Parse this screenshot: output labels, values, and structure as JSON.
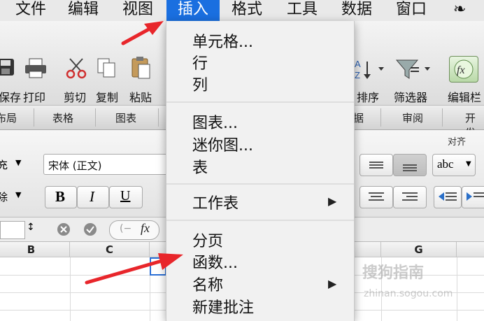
{
  "menubar": {
    "items": [
      "文件",
      "编辑",
      "视图",
      "插入",
      "格式",
      "工具",
      "数据",
      "窗口"
    ],
    "active_index": 3
  },
  "toolbar": {
    "save_label": "保存",
    "print_label": "打印",
    "cut_label": "剪切",
    "copy_label": "复制",
    "paste_label": "粘贴",
    "sort_label": "排序",
    "filter_label": "筛选器",
    "formula_builder_label": "编辑栏"
  },
  "ribbon_tabs": [
    "布局",
    "表格",
    "图表",
    "数据",
    "审阅",
    "开发"
  ],
  "format": {
    "section_label": "对齐",
    "font_name": "宋体 (正文)",
    "bold_label": "B",
    "italic_label": "I",
    "underline_label": "U",
    "wrap_label": "abc"
  },
  "formula_bar": {
    "fx_label": "fx"
  },
  "grid": {
    "columns": [
      "B",
      "C",
      "G"
    ]
  },
  "insert_menu": {
    "groups": [
      [
        {
          "label": "单元格...",
          "submenu": false
        },
        {
          "label": "行",
          "submenu": false
        },
        {
          "label": "列",
          "submenu": false
        }
      ],
      [
        {
          "label": "图表...",
          "submenu": false
        },
        {
          "label": "迷你图...",
          "submenu": false
        },
        {
          "label": "表",
          "submenu": false
        }
      ],
      [
        {
          "label": "工作表",
          "submenu": true
        }
      ],
      [
        {
          "label": "分页",
          "submenu": false
        },
        {
          "label": "函数...",
          "submenu": false
        },
        {
          "label": "名称",
          "submenu": true
        },
        {
          "label": "新建批注",
          "submenu": false
        }
      ]
    ],
    "arrow_glyph": "▶"
  },
  "colors": {
    "menu_highlight": "#1a6fe0",
    "annotation_arrow": "#e8262b"
  },
  "watermark": {
    "text": "搜狗指南",
    "sub": "zhinan.sogou.com"
  }
}
